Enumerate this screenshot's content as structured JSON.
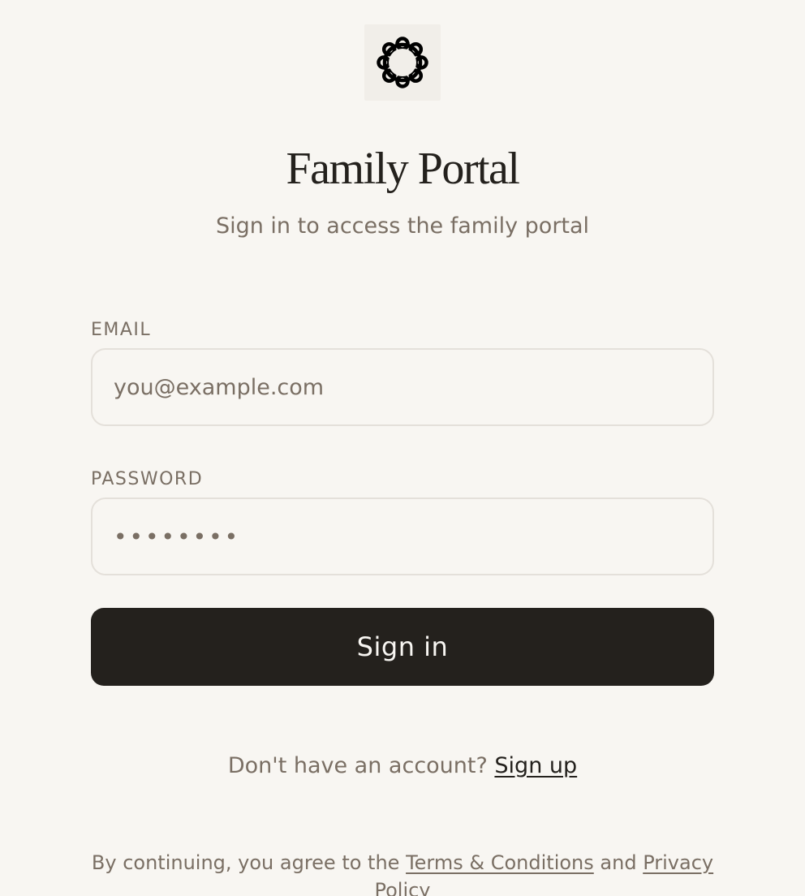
{
  "brand": {
    "logo_icon": "ornament-ring-icon",
    "title": "Family Portal",
    "subtitle": "Sign in to access the family portal"
  },
  "form": {
    "email_label": "EMAIL",
    "email_placeholder": "you@example.com",
    "email_value": "",
    "password_label": "PASSWORD",
    "password_value": "••••••••",
    "submit_label": "Sign in"
  },
  "signup": {
    "prompt": "Don't have an account?",
    "link_label": "Sign up"
  },
  "legal": {
    "prefix": "By continuing, you agree to the",
    "terms_label": "Terms & Conditions",
    "conjunction": "and",
    "privacy_label": "Privacy Policy"
  },
  "colors": {
    "background": "#f8f6f2",
    "primary": "#24211d",
    "muted": "#7a6f64",
    "border": "#e4e0da"
  }
}
